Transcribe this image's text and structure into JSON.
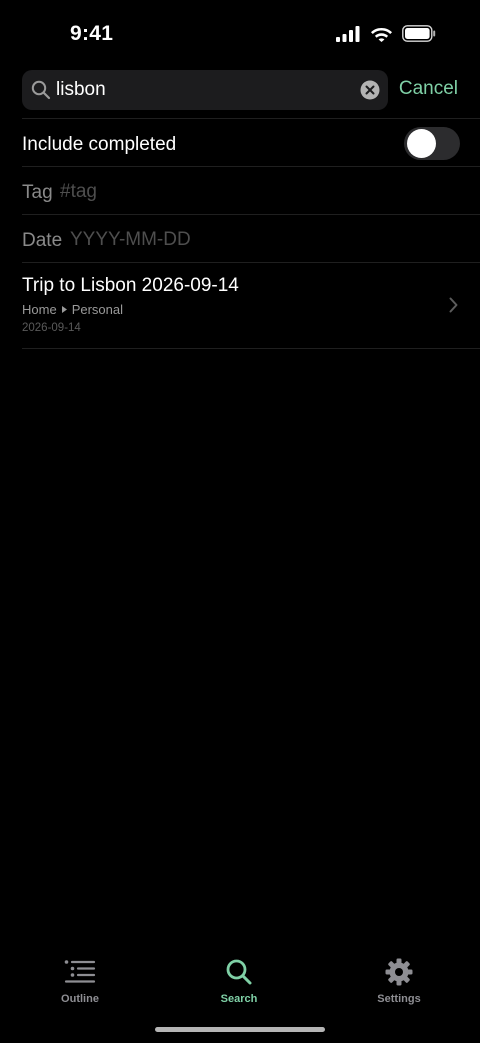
{
  "status_bar": {
    "time": "9:41"
  },
  "search": {
    "query": "lisbon",
    "cancel_label": "Cancel"
  },
  "filters": {
    "include_completed_label": "Include completed",
    "include_completed": false,
    "tag_label": "Tag",
    "tag_placeholder": "#tag",
    "date_label": "Date",
    "date_placeholder": "YYYY-MM-DD"
  },
  "results": [
    {
      "title": "Trip to Lisbon 2026-09-14",
      "path": [
        "Home",
        "Personal"
      ],
      "date": "2026-09-14"
    }
  ],
  "tabs": [
    {
      "label": "Outline",
      "icon": "outline-list-icon",
      "active": false
    },
    {
      "label": "Search",
      "icon": "search-icon",
      "active": true
    },
    {
      "label": "Settings",
      "icon": "gear-icon",
      "active": false
    }
  ],
  "colors": {
    "accent": "#7fd0a6",
    "inactive": "#8e8e93",
    "background": "#000000"
  }
}
